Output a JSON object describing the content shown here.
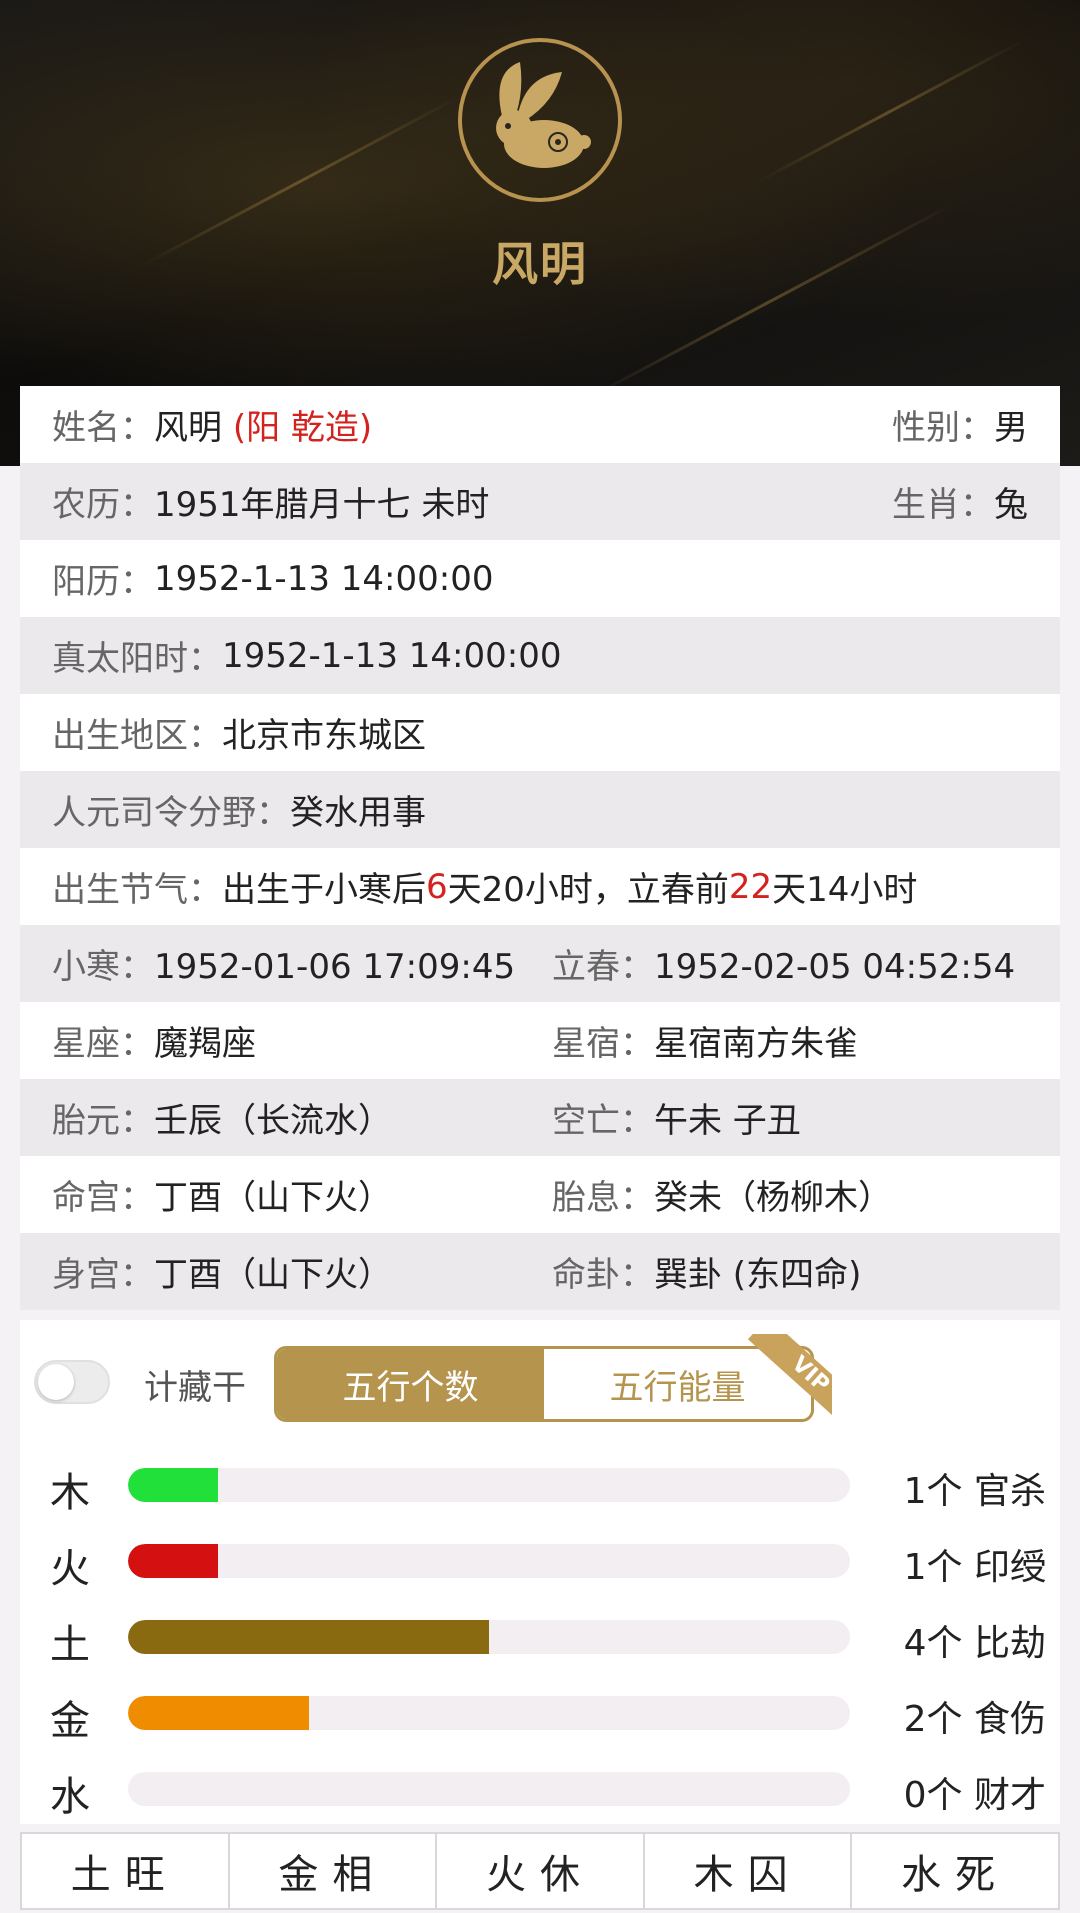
{
  "header": {
    "name": "风明",
    "emblem_icon": "rabbit-zodiac-icon"
  },
  "profile": {
    "name_label": "姓名：",
    "name_value": "风明",
    "name_tag": "(阳  乾造)",
    "gender_label": "性别：",
    "gender_value": "男",
    "lunar_label": "农历：",
    "lunar_value": "1951年腊月十七 未时",
    "zodiac_label": "生肖：",
    "zodiac_value": "兔",
    "solar_label": "阳历：",
    "solar_value": "1952-1-13 14:00:00",
    "true_solar_label": "真太阳时：",
    "true_solar_value": "1952-1-13 14:00:00",
    "birthplace_label": "出生地区：",
    "birthplace_value": "北京市东城区",
    "renyuan_label": "人元司令分野：",
    "renyuan_value": "癸水用事",
    "jieqi_label": "出生节气：",
    "jieqi_p1": "出生于小寒后",
    "jieqi_n1": "6",
    "jieqi_p2": "天20小时，立春前",
    "jieqi_n2": "22",
    "jieqi_p3": "天14小时",
    "xiaohan_label": "小寒：",
    "xiaohan_value": "1952-01-06 17:09:45",
    "lichun_label": "立春：",
    "lichun_value": "1952-02-05 04:52:54",
    "xingzuo_label": "星座：",
    "xingzuo_value": "魔羯座",
    "xingxiu_label": "星宿：",
    "xingxiu_value": "星宿南方朱雀",
    "taiyuan_label": "胎元：",
    "taiyuan_value": "壬辰（长流水）",
    "kongwang_label": "空亡：",
    "kongwang_value": "午未 子丑",
    "minggong_label": "命宫：",
    "minggong_value": "丁酉（山下火）",
    "taixi_label": "胎息：",
    "taixi_value": "癸未（杨柳木）",
    "shengong_label": "身宫：",
    "shengong_value": "丁酉（山下火）",
    "minggua_label": "命卦：",
    "minggua_value": "巽卦 (东四命)"
  },
  "wuxing": {
    "toggle_label": "计藏干",
    "toggle_on": false,
    "tab_count": "五行个数",
    "tab_energy": "五行能量",
    "vip_badge": "VIP",
    "max_count": 8,
    "items": [
      {
        "element": "木",
        "count": 1,
        "count_text": "1个 官杀",
        "color": "#22e03a"
      },
      {
        "element": "火",
        "count": 1,
        "count_text": "1个 印绶",
        "color": "#d41010"
      },
      {
        "element": "土",
        "count": 4,
        "count_text": "4个 比劫",
        "color": "#8a6a10"
      },
      {
        "element": "金",
        "count": 2,
        "count_text": "2个 食伤",
        "color": "#ef8c00"
      },
      {
        "element": "水",
        "count": 0,
        "count_text": "0个 财才",
        "color": "#3a6ad4"
      }
    ]
  },
  "states": [
    "土旺",
    "金相",
    "火休",
    "木囚",
    "水死"
  ]
}
